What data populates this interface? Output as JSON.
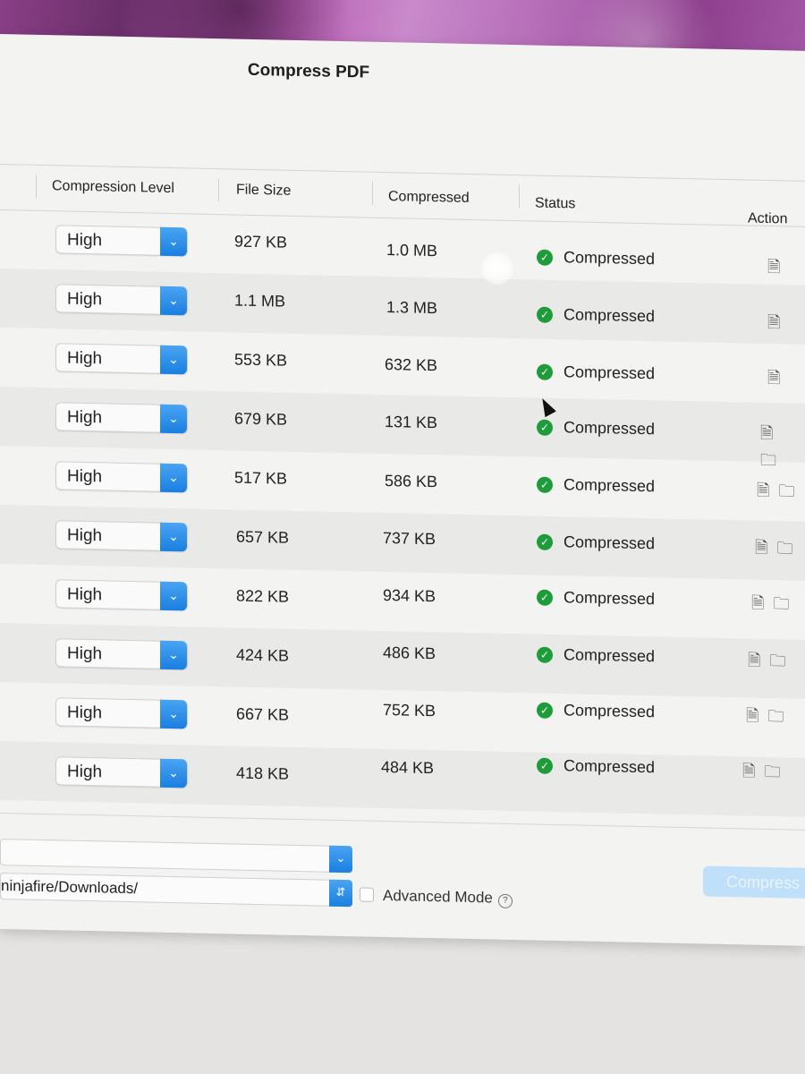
{
  "window": {
    "title": "Compress PDF"
  },
  "table": {
    "headers": {
      "compression_level": "Compression Level",
      "file_size": "File Size",
      "compressed": "Compressed",
      "status": "Status",
      "action": "Action"
    },
    "rows": [
      {
        "level": "High",
        "file_size": "927 KB",
        "compressed": "1.0 MB",
        "status": "Compressed"
      },
      {
        "level": "High",
        "file_size": "1.1 MB",
        "compressed": "1.3 MB",
        "status": "Compressed"
      },
      {
        "level": "High",
        "file_size": "553 KB",
        "compressed": "632 KB",
        "status": "Compressed"
      },
      {
        "level": "High",
        "file_size": "679 KB",
        "compressed": "131 KB",
        "status": "Compressed"
      },
      {
        "level": "High",
        "file_size": "517 KB",
        "compressed": "586 KB",
        "status": "Compressed"
      },
      {
        "level": "High",
        "file_size": "657 KB",
        "compressed": "737 KB",
        "status": "Compressed"
      },
      {
        "level": "High",
        "file_size": "822 KB",
        "compressed": "934 KB",
        "status": "Compressed"
      },
      {
        "level": "High",
        "file_size": "424 KB",
        "compressed": "486 KB",
        "status": "Compressed"
      },
      {
        "level": "High",
        "file_size": "667 KB",
        "compressed": "752 KB",
        "status": "Compressed"
      },
      {
        "level": "High",
        "file_size": "418 KB",
        "compressed": "484 KB",
        "status": "Compressed"
      }
    ]
  },
  "bottom": {
    "output_folder_value": "ninjafire/Downloads/",
    "advanced_mode_label": "Advanced Mode",
    "compress_button_label": "Compress"
  },
  "icons": {
    "select_chevron": "chevron-down-icon",
    "status": "check-circle-icon",
    "action_file": "file-icon",
    "action_folder": "folder-icon",
    "help": "help-icon"
  },
  "colors": {
    "accent": "#1a7fe0",
    "status_ok": "#1e9c3a",
    "compress_button_disabled": "#bfe0f8"
  }
}
